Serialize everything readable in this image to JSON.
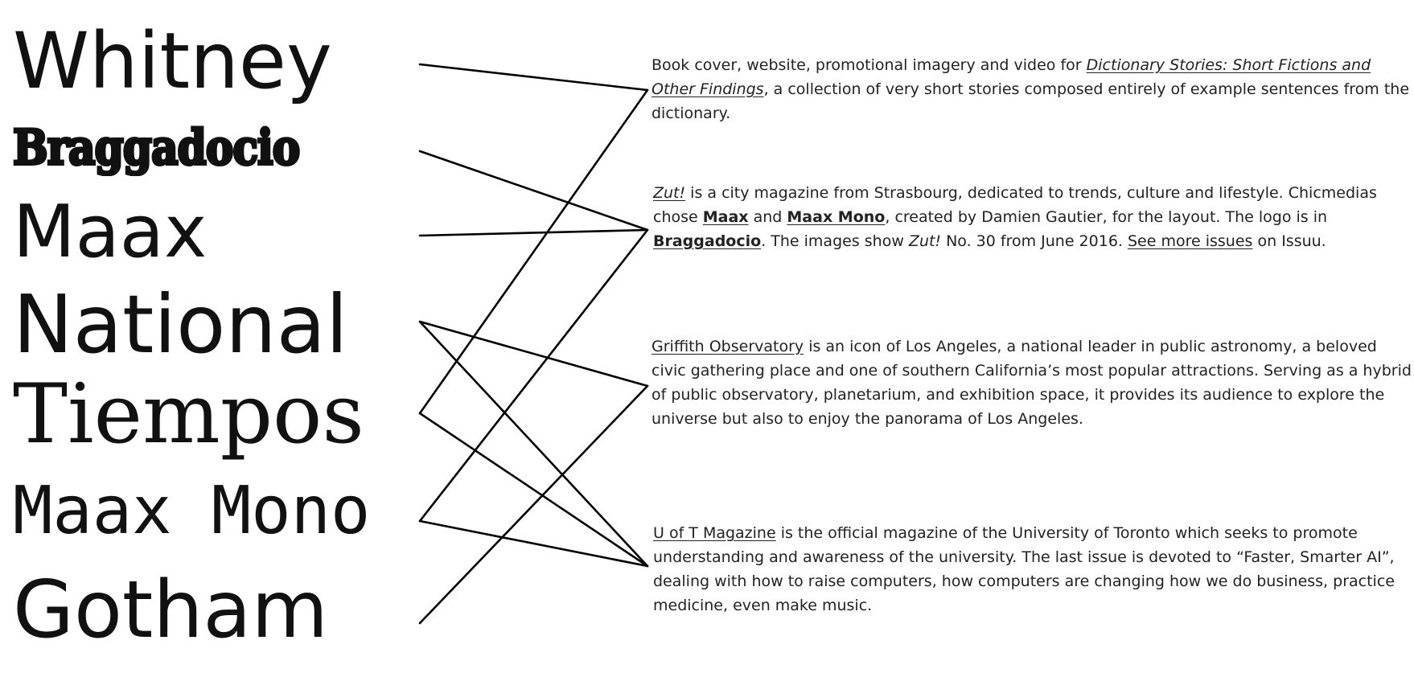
{
  "fonts": [
    "Whitney",
    "Braggadocio",
    "Maax",
    "National",
    "Tiempos",
    "Maax Mono",
    "Gotham"
  ],
  "descriptions": {
    "dictionary": {
      "text1": "Book cover, website, promotional imagery and video for ",
      "link": "Dictionary Stories: Short Fictions and Other Findings",
      "text2": ", a collection of very short stories composed entirely of example sentences from the dictionary."
    },
    "zut": {
      "title": "Zut!",
      "text1": " is a city magazine from Strasbourg, dedicated to trends, culture and lifestyle. Chicmedias chose ",
      "font1": "Maax",
      "text2": " and ",
      "font2": "Maax Mono",
      "text3": ", created by Damien Gautier, for the layout. The logo is in ",
      "font3": "Braggadocio",
      "text4": ". The images show ",
      "title2": "Zut!",
      "text5": " No. 30 from June 2016. ",
      "link": "See more issues",
      "text6": " on Issuu."
    },
    "griffith": {
      "link": "Griffith Observatory",
      "text": " is an icon of Los Angeles, a national leader in public astronomy, a beloved civic gathering place and one of southern California’s most popular attractions. Serving as a hybrid of public observatory, planetarium, and exhibition space, it provides its audience to explore the universe but also to enjoy the panorama of Los Angeles."
    },
    "uoft": {
      "link": "U of T Magazine",
      "text": " is the official magazine of the University of Toronto which seeks to promote understanding and awareness of the university. The last issue is devoted to “Faster, Smarter AI”, dealing with how to raise computers, how computers are changing how we do business, practice medicine, even make music."
    }
  },
  "connections": [
    {
      "font": "Whitney",
      "target": "dictionary"
    },
    {
      "font": "Braggadocio",
      "target": "zut"
    },
    {
      "font": "Maax",
      "target": "zut"
    },
    {
      "font": "National",
      "target": "griffith"
    },
    {
      "font": "National",
      "target": "uoft"
    },
    {
      "font": "Tiempos",
      "target": "dictionary"
    },
    {
      "font": "Tiempos",
      "target": "uoft"
    },
    {
      "font": "Maax Mono",
      "target": "zut"
    },
    {
      "font": "Maax Mono",
      "target": "uoft"
    },
    {
      "font": "Gotham",
      "target": "griffith"
    }
  ],
  "colors": {
    "line": "#000000",
    "text": "#222222"
  }
}
